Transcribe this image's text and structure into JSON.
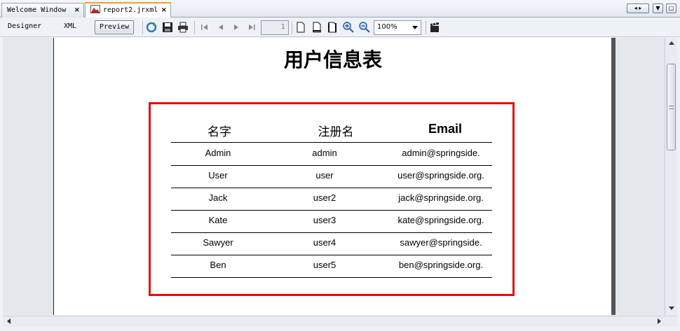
{
  "tabs": [
    {
      "label": "Welcome Window",
      "close": "×"
    },
    {
      "label": "report2.jrxml",
      "close": "×"
    }
  ],
  "toolbar": {
    "modes": [
      "Designer",
      "XML",
      "Preview"
    ],
    "page_number": "1",
    "zoom": "100%"
  },
  "report": {
    "title": "用户信息表",
    "columns": [
      "名字",
      "注册名",
      "Email"
    ],
    "rows": [
      [
        "Admin",
        "admin",
        "admin@springside."
      ],
      [
        "User",
        "user",
        "user@springside.org."
      ],
      [
        "Jack",
        "user2",
        "jack@springside.org."
      ],
      [
        "Kate",
        "user3",
        "kate@springside.org."
      ],
      [
        "Sawyer",
        "user4",
        "sawyer@springside."
      ],
      [
        "Ben",
        "user5",
        "ben@springside.org."
      ]
    ]
  },
  "colors": {
    "frame": "#e01010",
    "tab_accent": "#f0a030"
  }
}
